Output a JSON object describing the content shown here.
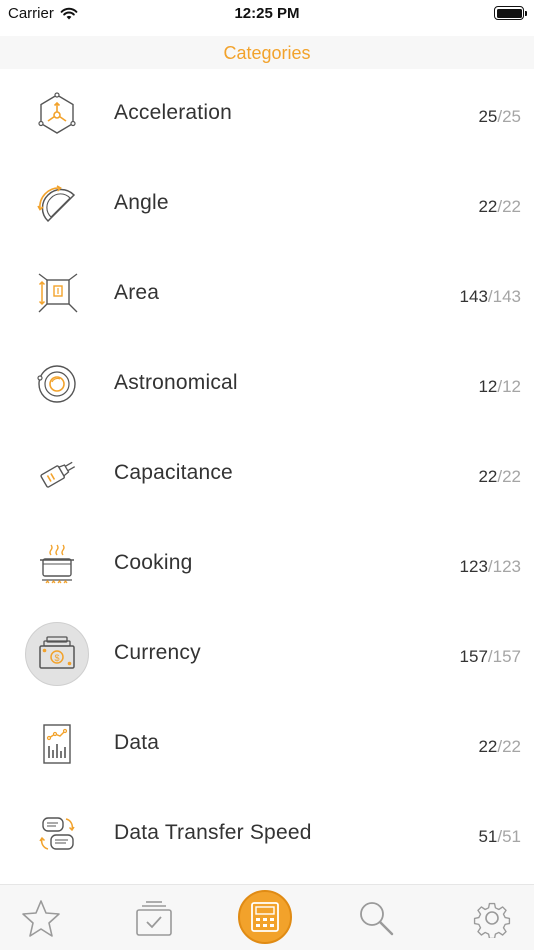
{
  "status_bar": {
    "carrier": "Carrier",
    "time": "12:25 PM"
  },
  "nav": {
    "title": "Categories"
  },
  "categories": [
    {
      "label": "Acceleration",
      "count": "25",
      "total": "/25",
      "icon": "acceleration-icon"
    },
    {
      "label": "Angle",
      "count": "22",
      "total": "/22",
      "icon": "protractor-icon"
    },
    {
      "label": "Area",
      "count": "143",
      "total": "/143",
      "icon": "area-icon"
    },
    {
      "label": "Astronomical",
      "count": "12",
      "total": "/12",
      "icon": "planet-orbit-icon"
    },
    {
      "label": "Capacitance",
      "count": "22",
      "total": "/22",
      "icon": "capacitor-icon"
    },
    {
      "label": "Cooking",
      "count": "123",
      "total": "/123",
      "icon": "cooking-pot-icon"
    },
    {
      "label": "Currency",
      "count": "157",
      "total": "/157",
      "icon": "currency-bills-icon",
      "selected": true
    },
    {
      "label": "Data",
      "count": "22",
      "total": "/22",
      "icon": "data-chart-icon"
    },
    {
      "label": "Data Transfer Speed",
      "count": "51",
      "total": "/51",
      "icon": "data-transfer-icon"
    }
  ],
  "tab_bar": {
    "tabs": [
      "favorites-star-icon",
      "categories-checklist-icon",
      "calculator-icon",
      "search-icon",
      "settings-gear-icon"
    ]
  },
  "colors": {
    "accent": "#f2a22b",
    "icon_stroke": "#555555",
    "count_total": "#a5a5a5",
    "nav_bg": "#f7f7f7"
  }
}
